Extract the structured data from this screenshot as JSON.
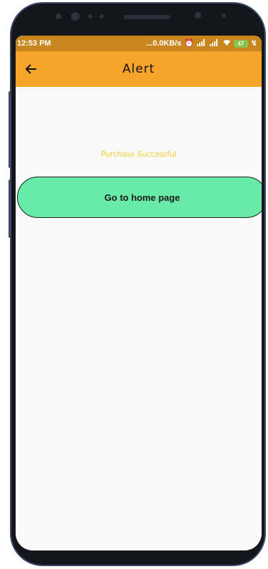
{
  "status_bar": {
    "time": "12:53 PM",
    "network_speed": "...0.0KB/s",
    "battery_level": "47",
    "icons": [
      "alarm-icon",
      "signal-icon",
      "signal-icon",
      "wifi-icon",
      "battery-icon",
      "charging-icon"
    ]
  },
  "app_bar": {
    "title": "Alert",
    "back_icon": "arrow-left-icon",
    "color": "#f6a42c"
  },
  "content": {
    "message": "Purchase Successful",
    "message_color": "#f3d03a",
    "home_button_label": "Go to home page",
    "home_button_color": "#68eaa8"
  }
}
